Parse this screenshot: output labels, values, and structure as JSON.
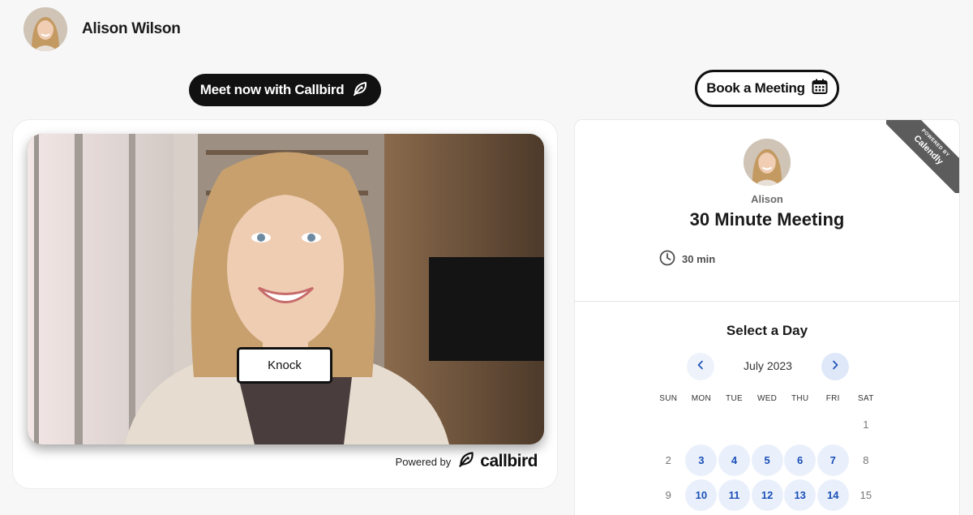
{
  "header": {
    "name": "Alison Wilson"
  },
  "actions": {
    "meet_now_label": "Meet now with Callbird",
    "book_meeting_label": "Book a Meeting"
  },
  "video": {
    "knock_label": "Knock",
    "powered_by": "Powered by",
    "brand": "callbird"
  },
  "calendly": {
    "ribbon_small": "POWERED BY",
    "ribbon_brand": "Calendly",
    "host": "Alison",
    "event_title": "30 Minute Meeting",
    "duration": "30 min",
    "select_day": "Select a Day",
    "month": "July 2023",
    "weekdays": [
      "SUN",
      "MON",
      "TUE",
      "WED",
      "THU",
      "FRI",
      "SAT"
    ],
    "weeks": [
      [
        {
          "d": ""
        },
        {
          "d": ""
        },
        {
          "d": ""
        },
        {
          "d": ""
        },
        {
          "d": ""
        },
        {
          "d": ""
        },
        {
          "d": "1",
          "avail": false
        }
      ],
      [
        {
          "d": "2",
          "avail": false
        },
        {
          "d": "3",
          "avail": true
        },
        {
          "d": "4",
          "avail": true
        },
        {
          "d": "5",
          "avail": true
        },
        {
          "d": "6",
          "avail": true
        },
        {
          "d": "7",
          "avail": true
        },
        {
          "d": "8",
          "avail": false
        }
      ],
      [
        {
          "d": "9",
          "avail": false
        },
        {
          "d": "10",
          "avail": true
        },
        {
          "d": "11",
          "avail": true
        },
        {
          "d": "12",
          "avail": true
        },
        {
          "d": "13",
          "avail": true
        },
        {
          "d": "14",
          "avail": true
        },
        {
          "d": "15",
          "avail": false
        }
      ]
    ]
  },
  "colors": {
    "accent_blue": "#1a4fb8",
    "available_bg": "#eaf0fb",
    "dark": "#111111"
  }
}
